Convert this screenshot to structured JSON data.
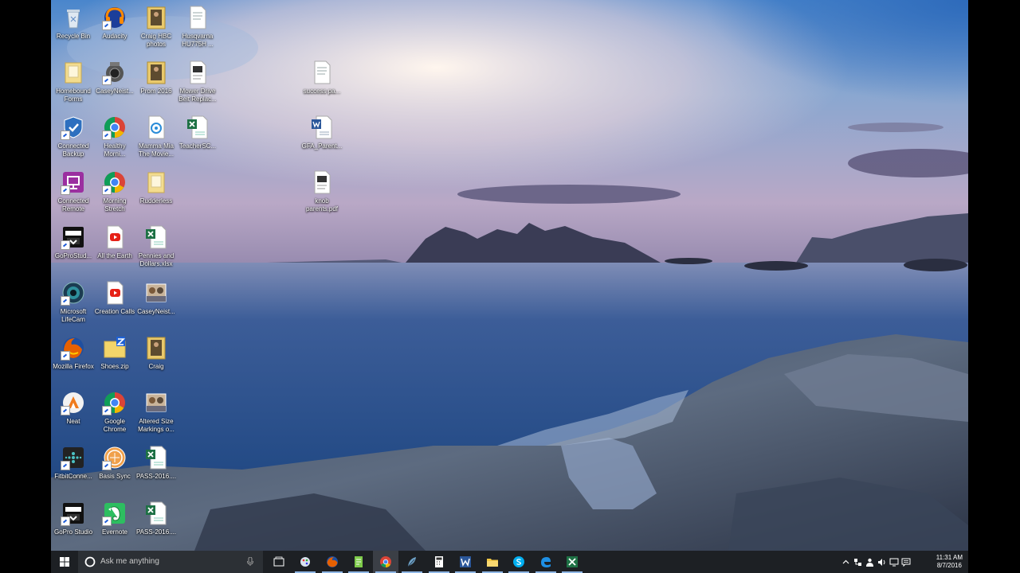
{
  "desktop": {
    "icons": [
      {
        "label": "Recycle Bin",
        "icon": "recycle-bin-icon"
      },
      {
        "label": "Audacity",
        "icon": "audacity-icon"
      },
      {
        "label": "Craig HBC photos",
        "icon": "folder-photo-icon"
      },
      {
        "label": "Husqvarna HU775H ...",
        "icon": "document-icon"
      },
      {
        "label": "Homebound Forms",
        "icon": "folder-icon"
      },
      {
        "label": "CaseyNeist...",
        "icon": "video-camera-icon"
      },
      {
        "label": "Prom 2016",
        "icon": "folder-photo-icon"
      },
      {
        "label": "Mower Drive Belt Replac...",
        "icon": "pdf-document-icon"
      },
      {
        "label": "Connected Backup",
        "icon": "connected-backup-icon"
      },
      {
        "label": "Healthy Morni...",
        "icon": "chrome-icon"
      },
      {
        "label": "Mamma Mia The Movie...",
        "icon": "media-file-icon"
      },
      {
        "label": "TeacherSC...",
        "icon": "excel-icon"
      },
      {
        "label": "Connected Remote",
        "icon": "connected-remote-icon"
      },
      {
        "label": "Morning Stretch",
        "icon": "chrome-icon"
      },
      {
        "label": "Rudderless",
        "icon": "folder-icon"
      },
      {
        "label": "GoProStud...",
        "icon": "gopro-icon"
      },
      {
        "label": "All the Earth",
        "icon": "youtube-icon"
      },
      {
        "label": "Pennies and Dollars.xlsx",
        "icon": "excel-icon"
      },
      {
        "label": "Microsoft LifeCam",
        "icon": "lifecam-icon"
      },
      {
        "label": "Creation Calls",
        "icon": "youtube-icon"
      },
      {
        "label": "CaseyNeist...",
        "icon": "photo-icon"
      },
      {
        "label": "Mozilla Firefox",
        "icon": "firefox-icon"
      },
      {
        "label": "Shoes.zip",
        "icon": "zip-folder-icon"
      },
      {
        "label": "Craig",
        "icon": "folder-photo-icon"
      },
      {
        "label": "Neat",
        "icon": "neat-icon"
      },
      {
        "label": "Google Chrome",
        "icon": "chrome-icon"
      },
      {
        "label": "Altered Size Markings o...",
        "icon": "photo-icon"
      },
      {
        "label": "FitbitConne...",
        "icon": "fitbit-icon"
      },
      {
        "label": "Basis Sync",
        "icon": "basis-sync-icon"
      },
      {
        "label": "PASS-2016....",
        "icon": "excel-icon"
      },
      {
        "label": "GoPro Studio",
        "icon": "gopro-icon"
      },
      {
        "label": "Evernote",
        "icon": "evernote-icon"
      },
      {
        "label": "PASS-2016....",
        "icon": "excel-icon"
      },
      {
        "label": "success pa...",
        "icon": "document-icon"
      },
      {
        "label": "GFA_Parent...",
        "icon": "word-icon"
      },
      {
        "label": "knob parents.pdf",
        "icon": "pdf-document-icon"
      }
    ]
  },
  "taskbar": {
    "search_placeholder": "Ask me anything",
    "apps": [
      "task-view-icon",
      "paint-icon",
      "firefox-icon",
      "notepad-icon",
      "chrome-icon",
      "feather-icon",
      "calculator-icon",
      "word-icon",
      "file-explorer-icon",
      "skype-icon",
      "edge-icon",
      "excel-icon"
    ],
    "tray": [
      "chevron-up-icon",
      "network-icon",
      "people-icon",
      "speaker-icon",
      "monitor-icon",
      "notifications-icon"
    ],
    "time": "11:31 AM",
    "date": "8/7/2016"
  },
  "colors": {
    "taskbar": "#1d2024",
    "active_app_highlight": "#3b3f46",
    "sky_top": "#3f7fc5",
    "sea": "#2a4f87"
  }
}
